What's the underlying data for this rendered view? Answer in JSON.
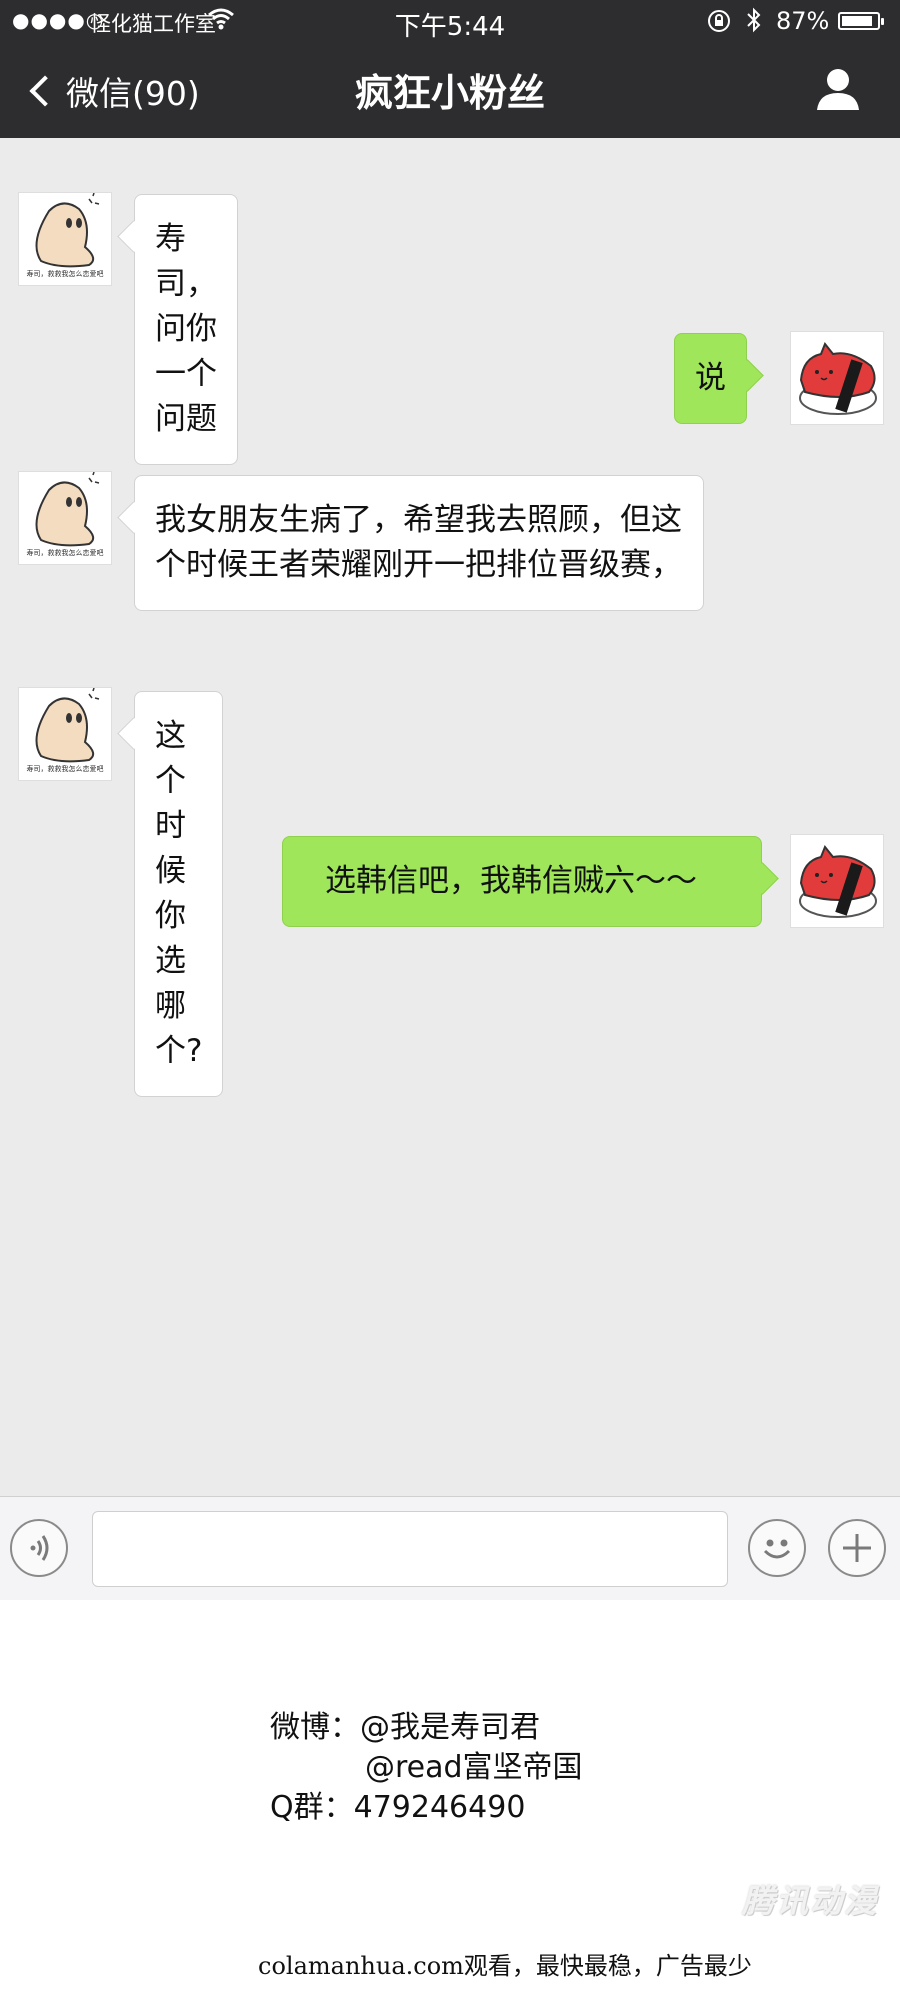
{
  "status_bar": {
    "signal": "●●●●○",
    "carrier": "怪化猫工作室",
    "time": "下午5:44",
    "battery_percent": "87%",
    "battery_level": 0.87
  },
  "nav": {
    "back_label": "微信(90)",
    "title": "疯狂小粉丝"
  },
  "messages": [
    {
      "side": "left",
      "text": "寿司，问你一个问题"
    },
    {
      "side": "right",
      "text": "说"
    },
    {
      "side": "left",
      "text": "我女朋友生病了，希望我去照顾，但这个时候王者荣耀刚开一把排位晋级赛，"
    },
    {
      "side": "left",
      "text": "这个时候你选哪个?"
    },
    {
      "side": "right",
      "text": "选韩信吧，我韩信贼六～～"
    }
  ],
  "avatar_caption": "寿司，救救我怎么恋爱吧",
  "input_bar": {
    "icons": [
      "voice-icon",
      "emoji-icon",
      "plus-icon"
    ],
    "placeholder": ""
  },
  "credits": {
    "weibo_label": "微博：",
    "weibo_1": "@我是寿司君",
    "weibo_2": "@read富坚帝国",
    "qq_label": "Q群：",
    "qq_number": "479246490"
  },
  "watermark": "腾讯动漫",
  "source_text": "colamanhua.com观看，最快最稳，广告最少",
  "colors": {
    "bar": "#2d2d2f",
    "chat_bg": "#ebebeb",
    "bubble_right": "#9fe65a",
    "bubble_left": "#ffffff"
  }
}
